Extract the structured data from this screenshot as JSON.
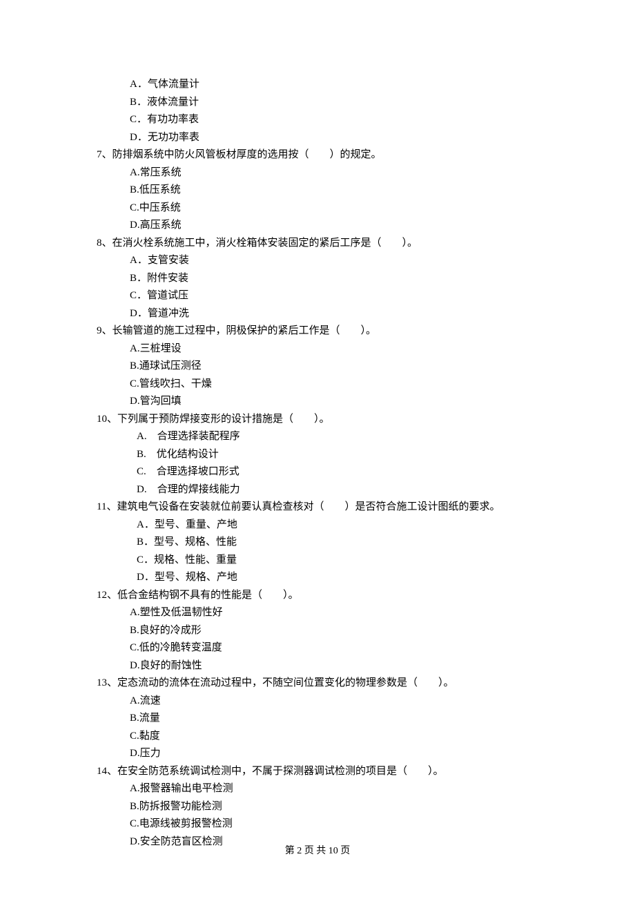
{
  "continued_options": [
    "A．气体流量计",
    "B．液体流量计",
    "C．有功功率表",
    "D．无功功率表"
  ],
  "questions": [
    {
      "num": "7、",
      "stem": "防排烟系统中防火风管板材厚度的选用按（　　）的规定。",
      "opts": [
        "A.常压系统",
        "B.低压系统",
        "C.中压系统",
        "D.高压系统"
      ],
      "wide": false
    },
    {
      "num": "8、",
      "stem": "在消火栓系统施工中，消火栓箱体安装固定的紧后工序是（　　）。",
      "opts": [
        "A．支管安装",
        "B．附件安装",
        "C．管道试压",
        "D．管道冲洗"
      ],
      "wide": false
    },
    {
      "num": "9、",
      "stem": "长输管道的施工过程中，阴极保护的紧后工作是（　　）。",
      "opts": [
        "A.三桩埋设",
        "B.通球试压测径",
        "C.管线吹扫、干燥",
        "D.管沟回填"
      ],
      "wide": false
    },
    {
      "num": "10、",
      "stem": "下列属于预防焊接变形的设计措施是（　　）。",
      "opts": [
        "A.　合理选择装配程序",
        "B.　优化结构设计",
        "C.　合理选择坡口形式",
        "D.　合理的焊接线能力"
      ],
      "wide": true
    },
    {
      "num": "11、",
      "stem": "建筑电气设备在安装就位前要认真检查核对（　　）是否符合施工设计图纸的要求。",
      "opts": [
        "A．型号、重量、产地",
        "B．型号、规格、性能",
        "C．规格、性能、重量",
        "D．型号、规格、产地"
      ],
      "wide": true
    },
    {
      "num": "12、",
      "stem": "低合金结构钢不具有的性能是（　　）。",
      "opts": [
        "A.塑性及低温韧性好",
        "B.良好的冷成形",
        "C.低的冷脆转变温度",
        "D.良好的耐蚀性"
      ],
      "wide": false
    },
    {
      "num": "13、",
      "stem": "定态流动的流体在流动过程中，不随空间位置变化的物理参数是（　　）。",
      "opts": [
        "A.流速",
        "B.流量",
        "C.黏度",
        "D.压力"
      ],
      "wide": false
    },
    {
      "num": "14、",
      "stem": "在安全防范系统调试检测中，不属于探测器调试检测的项目是（　　）。",
      "opts": [
        "A.报警器输出电平检测",
        "B.防拆报警功能检测",
        "C.电源线被剪报警检测",
        "D.安全防范盲区检测"
      ],
      "wide": false
    }
  ],
  "footer": "第 2 页 共 10 页"
}
